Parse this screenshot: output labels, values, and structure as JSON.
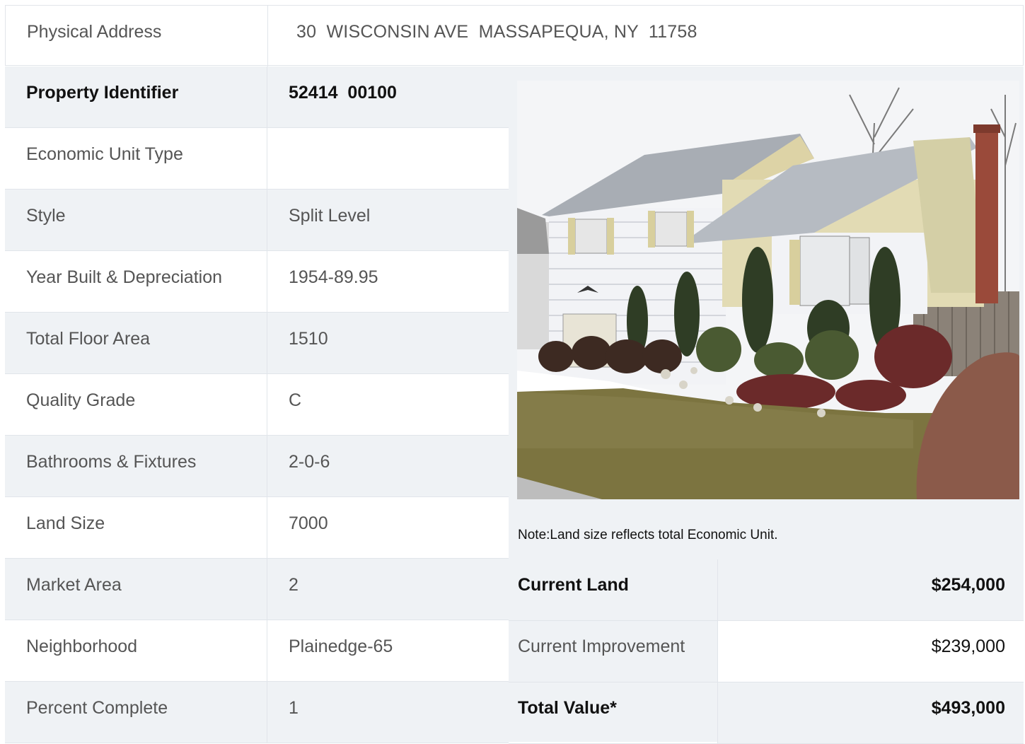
{
  "address": {
    "label": "Physical Address",
    "value": "30  WISCONSIN AVE  MASSAPEQUA, NY  11758"
  },
  "details": [
    {
      "label": "Property Identifier",
      "value": "52414  00100"
    },
    {
      "label": "Economic Unit Type",
      "value": ""
    },
    {
      "label": "Style",
      "value": "Split Level"
    },
    {
      "label": "Year Built & Depreciation",
      "value": "1954-89.95"
    },
    {
      "label": "Total Floor Area",
      "value": "1510"
    },
    {
      "label": "Quality Grade",
      "value": "C"
    },
    {
      "label": "Bathrooms & Fixtures",
      "value": "2-0-6"
    },
    {
      "label": "Land Size",
      "value": "7000"
    },
    {
      "label": "Market Area",
      "value": "2"
    },
    {
      "label": "Neighborhood",
      "value": "Plainedge-65"
    },
    {
      "label": "Percent Complete",
      "value": "1"
    }
  ],
  "note": "Note:Land size reflects total Economic Unit.",
  "values": [
    {
      "label": "Current Land",
      "value": "$254,000"
    },
    {
      "label": "Current Improvement",
      "value": "$239,000"
    },
    {
      "label": "Total Value*",
      "value": "$493,000"
    }
  ],
  "colors": {
    "row_shade": "#eff2f5",
    "border": "#e1e5ea",
    "text_muted": "#555555",
    "text_strong": "#111111"
  }
}
